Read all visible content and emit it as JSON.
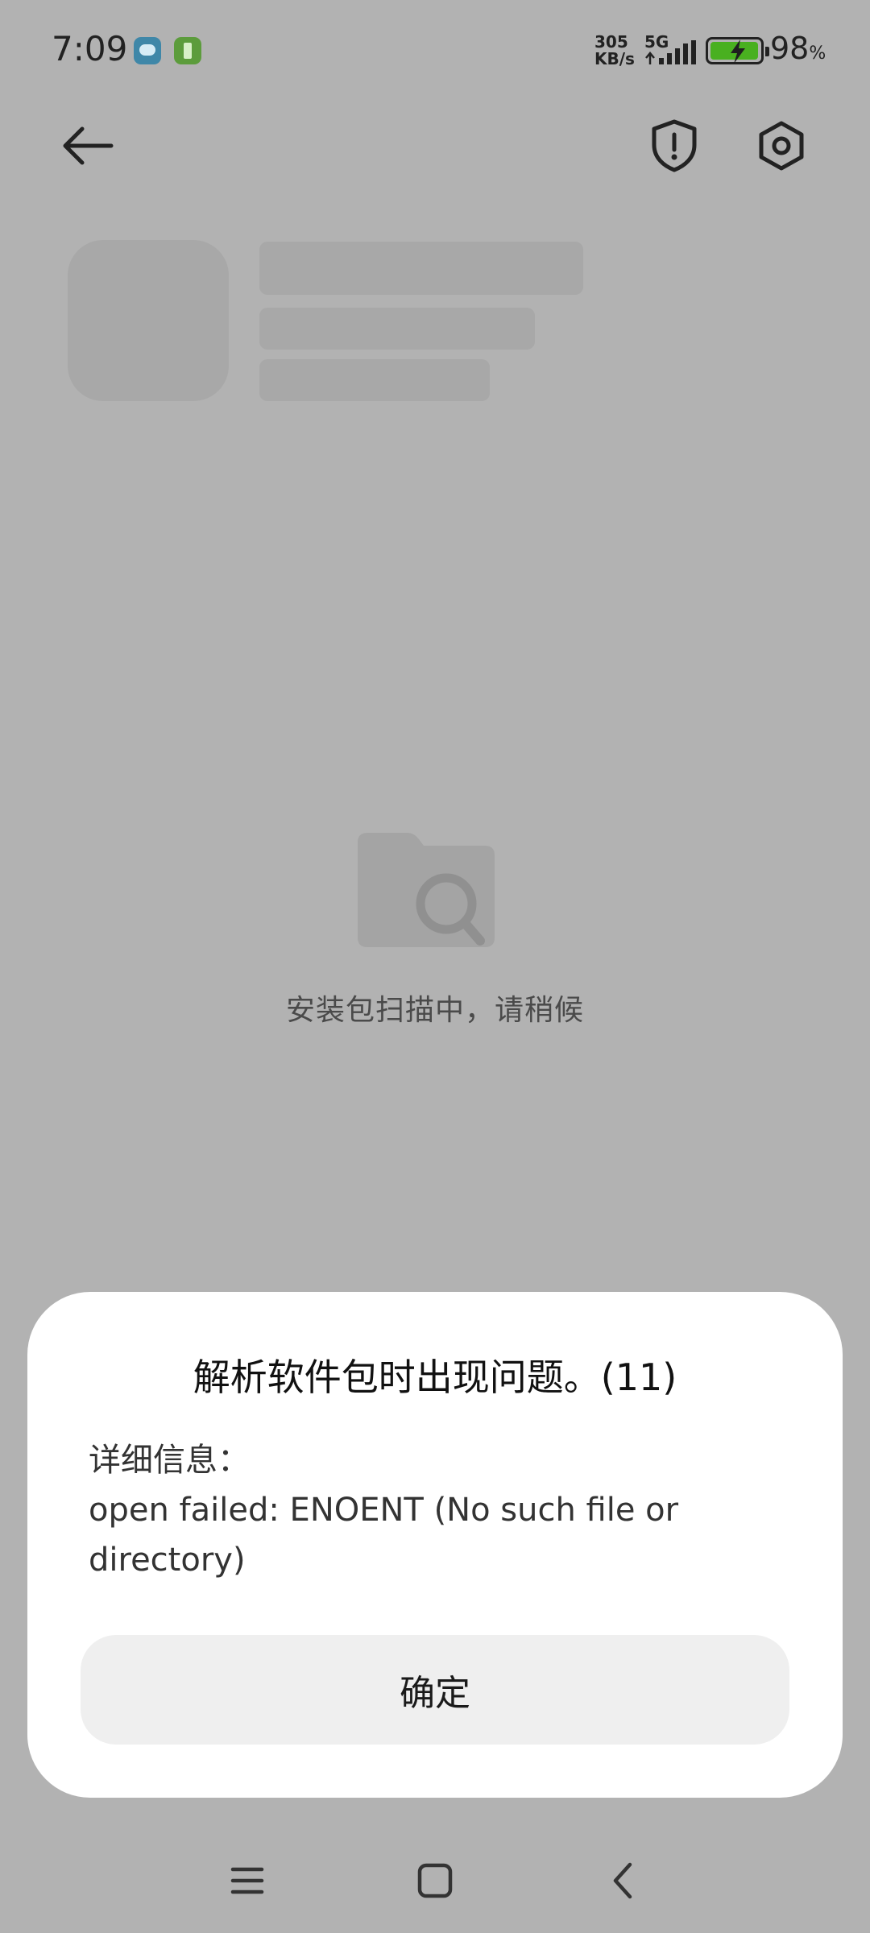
{
  "status_bar": {
    "time": "7:09",
    "net_speed_value": "305",
    "net_speed_unit": "KB/s",
    "network_type": "5G",
    "battery_percent": "98",
    "battery_percent_sign": "%",
    "battery_level": 0.98,
    "notification_icons": [
      "cloud-app-icon",
      "battery-app-icon"
    ]
  },
  "toolbar": {
    "back_icon": "arrow-left-icon",
    "security_icon": "shield-exclamation-icon",
    "settings_icon": "gear-icon"
  },
  "scanning": {
    "icon": "folder-search-icon",
    "message": "安装包扫描中，请稍候"
  },
  "dialog": {
    "title": "解析软件包时出现问题。(11)",
    "detail_label": "详细信息：",
    "detail_text": "open failed: ENOENT (No such file or directory)",
    "confirm_label": "确定"
  },
  "nav_bar": {
    "menu_icon": "menu-icon",
    "home_icon": "home-square-icon",
    "back_icon": "chevron-left-icon"
  },
  "colors": {
    "scrim": "#b2b2b2",
    "dialog_bg": "#ffffff",
    "button_bg": "#efefef",
    "battery_fill": "#49b020"
  }
}
